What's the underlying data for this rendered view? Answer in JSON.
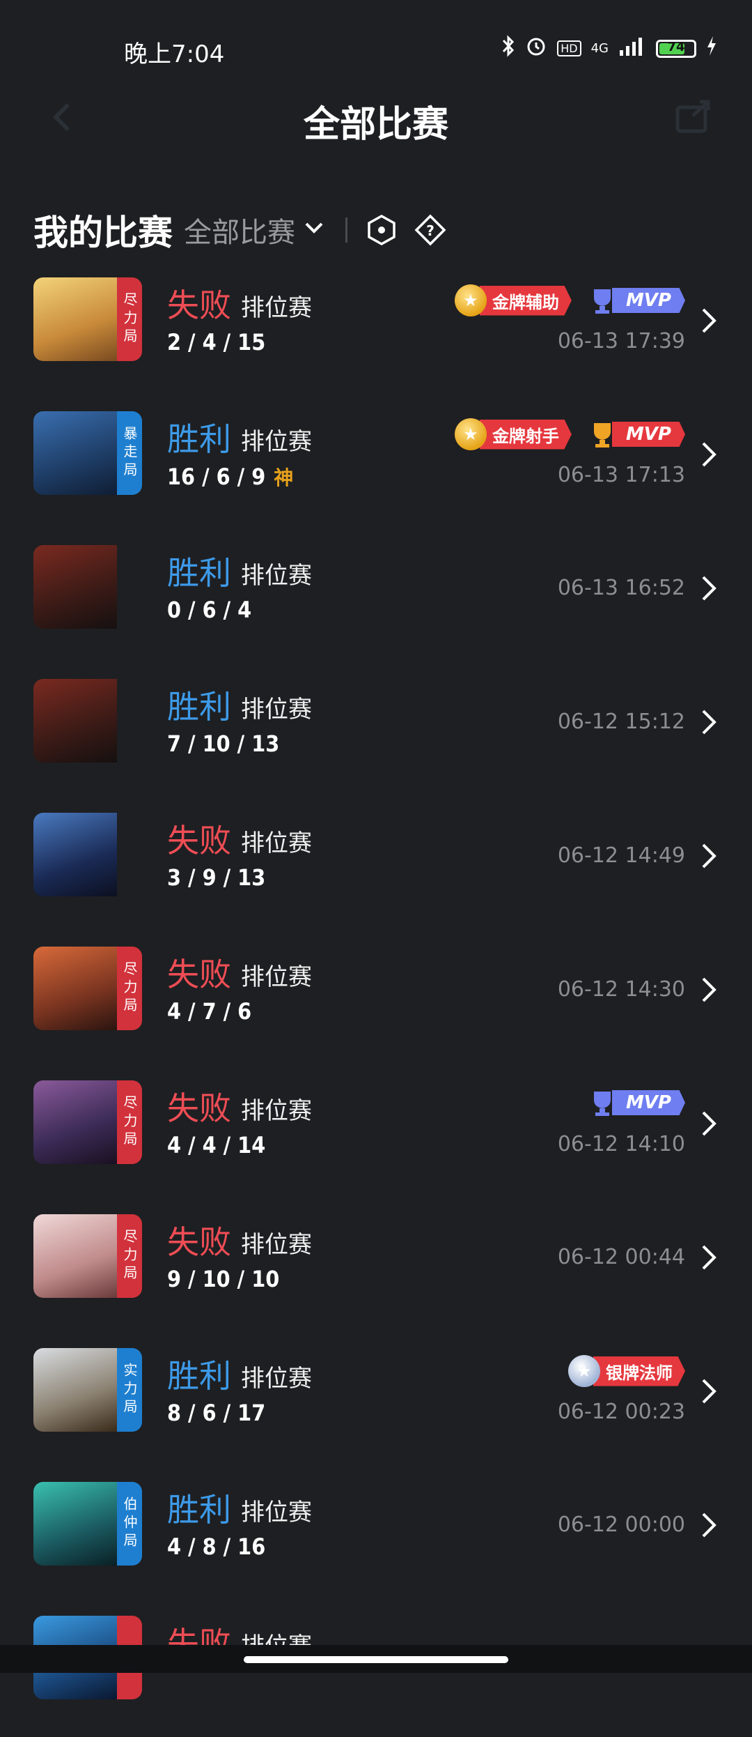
{
  "status_bar": {
    "time": "晚上7:04",
    "network": "4G",
    "battery_level": "74",
    "hd": "HD"
  },
  "header": {
    "title": "全部比赛"
  },
  "section": {
    "title": "我的比赛",
    "filter_label": "全部比赛"
  },
  "colors": {
    "lose": "#ef4d55",
    "win": "#3d9ae8",
    "tag_red": "#d2323c",
    "tag_blue": "#1e7fd0",
    "background": "#1e1f22"
  },
  "matches": [
    {
      "result": "失败",
      "mode": "排位赛",
      "kda": "2 / 4 / 15",
      "date": "06-13 17:39",
      "tag": "尽力局",
      "medal": "金牌辅助",
      "mvp": "MVP"
    },
    {
      "result": "胜利",
      "mode": "排位赛",
      "kda": "16 / 6 / 9",
      "extra": "神",
      "date": "06-13 17:13",
      "tag": "暴走局",
      "medal": "金牌射手",
      "mvp": "MVP"
    },
    {
      "result": "胜利",
      "mode": "排位赛",
      "kda": "0 / 6 / 4",
      "date": "06-13 16:52"
    },
    {
      "result": "胜利",
      "mode": "排位赛",
      "kda": "7 / 10 / 13",
      "date": "06-12 15:12"
    },
    {
      "result": "失败",
      "mode": "排位赛",
      "kda": "3 / 9 / 13",
      "date": "06-12 14:49"
    },
    {
      "result": "失败",
      "mode": "排位赛",
      "kda": "4 / 7 / 6",
      "date": "06-12 14:30",
      "tag": "尽力局"
    },
    {
      "result": "失败",
      "mode": "排位赛",
      "kda": "4 / 4 / 14",
      "date": "06-12 14:10",
      "tag": "尽力局",
      "mvp": "MVP"
    },
    {
      "result": "失败",
      "mode": "排位赛",
      "kda": "9 / 10 / 10",
      "date": "06-12 00:44",
      "tag": "尽力局"
    },
    {
      "result": "胜利",
      "mode": "排位赛",
      "kda": "8 / 6 / 17",
      "date": "06-12 00:23",
      "tag": "实力局",
      "medal": "银牌法师"
    },
    {
      "result": "胜利",
      "mode": "排位赛",
      "kda": "4 / 8 / 16",
      "date": "06-12 00:00",
      "tag": "伯仲局"
    },
    {
      "result": "失败",
      "mode": "排位赛",
      "tag": "尽"
    }
  ]
}
